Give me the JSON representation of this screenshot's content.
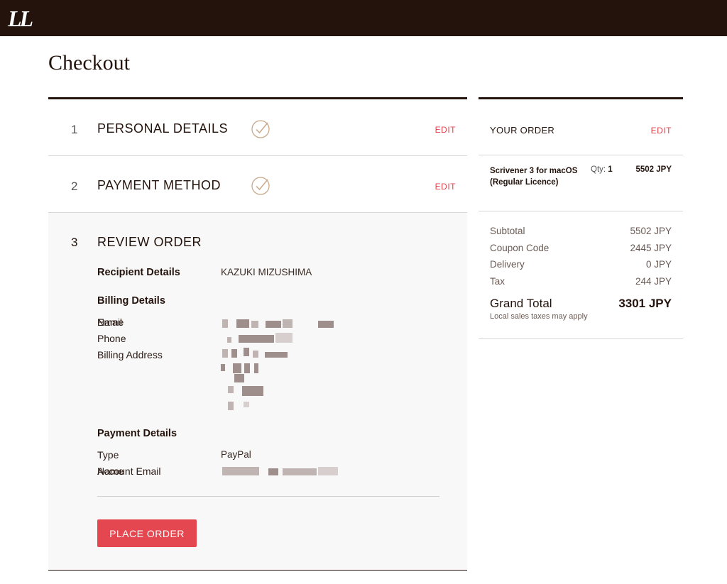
{
  "header": {
    "logo": "LL"
  },
  "page": {
    "title": "Checkout"
  },
  "steps": [
    {
      "number": "1",
      "title": "PERSONAL DETAILS",
      "edit": "EDIT",
      "status_icon": "check-circle-icon"
    },
    {
      "number": "2",
      "title": "PAYMENT METHOD",
      "edit": "EDIT",
      "status_icon": "check-circle-icon"
    },
    {
      "number": "3",
      "title": "REVIEW ORDER"
    }
  ],
  "review": {
    "recipient_heading": "Recipient Details",
    "recipient_value": "KAZUKI MIZUSHIMA",
    "billing_heading": "Billing Details",
    "billing_name_label": "Name",
    "billing_email_label": "Email",
    "billing_phone_label": "Phone",
    "billing_address_label": "Billing Address",
    "payment_heading": "Payment Details",
    "payment_type_label": "Type",
    "payment_type_value": "PayPal",
    "payment_name_label": "Name",
    "payment_email_label": "Account Email",
    "place_order": "PLACE ORDER"
  },
  "order": {
    "title": "YOUR ORDER",
    "edit": "EDIT",
    "item_name": "Scrivener 3 for macOS (Regular Licence)",
    "qty_label": "Qty:",
    "qty_value": "1",
    "item_price": "5502 JPY",
    "subtotal_label": "Subtotal",
    "subtotal_value": "5502 JPY",
    "coupon_label": "Coupon Code",
    "coupon_value": "2445 JPY",
    "delivery_label": "Delivery",
    "delivery_value": "0 JPY",
    "tax_label": "Tax",
    "tax_value": "244 JPY",
    "grand_label": "Grand Total",
    "grand_value": "3301 JPY",
    "tax_note": "Local sales taxes may apply"
  },
  "colors": {
    "header_bg": "#24130c",
    "accent": "#e4474f",
    "check": "#c9a98a"
  }
}
